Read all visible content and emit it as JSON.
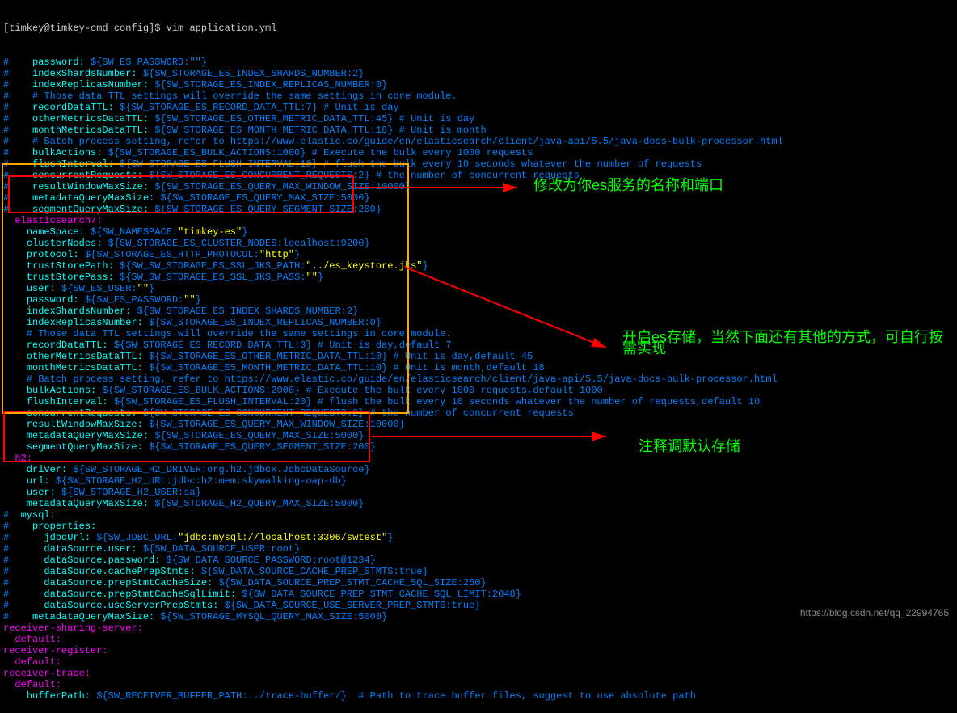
{
  "prompt": "[timkey@timkey-cmd config]$ vim application.yml",
  "lines": [
    {
      "h": "#",
      "k": "    password:",
      "v": " ${SW_ES_PASSWORD:\"\"}"
    },
    {
      "h": "#",
      "k": "    indexShardsNumber:",
      "v": " ${SW_STORAGE_ES_INDEX_SHARDS_NUMBER:2}"
    },
    {
      "h": "#",
      "k": "    indexReplicasNumber:",
      "v": " ${SW_STORAGE_ES_INDEX_REPLICAS_NUMBER:0}"
    },
    {
      "h": "#",
      "c": "    # Those data TTL settings will override the same settings in core module."
    },
    {
      "h": "#",
      "k": "    recordDataTTL:",
      "v": " ${SW_STORAGE_ES_RECORD_DATA_TTL:7}",
      "c": " # Unit is day"
    },
    {
      "h": "#",
      "k": "    otherMetricsDataTTL:",
      "v": " ${SW_STORAGE_ES_OTHER_METRIC_DATA_TTL:45}",
      "c": " # Unit is day"
    },
    {
      "h": "#",
      "k": "    monthMetricsDataTTL:",
      "v": " ${SW_STORAGE_ES_MONTH_METRIC_DATA_TTL:18}",
      "c": " # Unit is month"
    },
    {
      "h": "#",
      "c": "    # Batch process setting, refer to https://www.elastic.co/guide/en/elasticsearch/client/java-api/5.5/java-docs-bulk-processor.html"
    },
    {
      "h": "#",
      "k": "    bulkActions:",
      "v": " ${SW_STORAGE_ES_BULK_ACTIONS:1000}",
      "c": " # Execute the bulk every 1000 requests"
    },
    {
      "h": "#",
      "k": "    flushInterval:",
      "v": " ${SW_STORAGE_ES_FLUSH_INTERVAL:10}",
      "c": " # flush the bulk every 10 seconds whatever the number of requests"
    },
    {
      "h": "#",
      "k": "    concurrentRequests:",
      "v": " ${SW_STORAGE_ES_CONCURRENT_REQUESTS:2}",
      "c": " # the number of concurrent requests"
    },
    {
      "h": "#",
      "k": "    resultWindowMaxSize:",
      "v": " ${SW_STORAGE_ES_QUERY_MAX_WINDOW_SIZE:10000}"
    },
    {
      "h": "#",
      "k": "    metadataQueryMaxSize:",
      "v": " ${SW_STORAGE_ES_QUERY_MAX_SIZE:5000}"
    },
    {
      "h": "#",
      "k": "    segmentQueryMaxSize:",
      "v": " ${SW_STORAGE_ES_QUERY_SEGMENT_SIZE:200}"
    },
    {
      "k": "  elasticsearch7:",
      "sect": true
    },
    {
      "k": "    nameSpace:",
      "v": " ${SW_NAMESPACE:",
      "str": "\"timkey-es\"",
      "v2": "}"
    },
    {
      "k": "    clusterNodes:",
      "v": " ${SW_STORAGE_ES_CLUSTER_NODES:localhost:9200}"
    },
    {
      "k": "    protocol:",
      "v": " ${SW_STORAGE_ES_HTTP_PROTOCOL:",
      "str": "\"http\"",
      "v2": "}"
    },
    {
      "k": "    trustStorePath:",
      "v": " ${SW_SW_STORAGE_ES_SSL_JKS_PATH:",
      "str": "\"../es_keystore.jks\"",
      "v2": "}"
    },
    {
      "k": "    trustStorePass:",
      "v": " ${SW_SW_STORAGE_ES_SSL_JKS_PASS:",
      "str": "\"\"",
      "v2": "}"
    },
    {
      "k": "    user:",
      "v": " ${SW_ES_USER:",
      "str": "\"\"",
      "v2": "}"
    },
    {
      "k": "    password:",
      "v": " ${SW_ES_PASSWORD:",
      "str": "\"\"",
      "v2": "}"
    },
    {
      "k": "    indexShardsNumber:",
      "v": " ${SW_STORAGE_ES_INDEX_SHARDS_NUMBER:2}"
    },
    {
      "k": "    indexReplicasNumber:",
      "v": " ${SW_STORAGE_ES_INDEX_REPLICAS_NUMBER:0}"
    },
    {
      "c": "    # Those data TTL settings will override the same settings in core module."
    },
    {
      "k": "    recordDataTTL:",
      "v": " ${SW_STORAGE_ES_RECORD_DATA_TTL:3}",
      "c": " # Unit is day,default 7"
    },
    {
      "k": "    otherMetricsDataTTL:",
      "v": " ${SW_STORAGE_ES_OTHER_METRIC_DATA_TTL:10}",
      "c": " # Unit is day,default 45"
    },
    {
      "k": "    monthMetricsDataTTL:",
      "v": " ${SW_STORAGE_ES_MONTH_METRIC_DATA_TTL:10}",
      "c": " # Unit is month,default 18"
    },
    {
      "c": "    # Batch process setting, refer to https://www.elastic.co/guide/en/elasticsearch/client/java-api/5.5/java-docs-bulk-processor.html"
    },
    {
      "k": "    bulkActions:",
      "v": " ${SW_STORAGE_ES_BULK_ACTIONS:2000}",
      "c": " # Execute the bulk every 1000 requests,default 1000"
    },
    {
      "k": "    flushInterval:",
      "v": " ${SW_STORAGE_ES_FLUSH_INTERVAL:20}",
      "c": " # flush the bulk every 10 seconds whatever the number of requests,default 10"
    },
    {
      "k": "    concurrentRequests:",
      "v": " ${SW_STORAGE_ES_CONCURRENT_REQUESTS:2}",
      "c": " # the number of concurrent requests"
    },
    {
      "k": "    resultWindowMaxSize:",
      "v": " ${SW_STORAGE_ES_QUERY_MAX_WINDOW_SIZE:10000}"
    },
    {
      "k": "    metadataQueryMaxSize:",
      "v": " ${SW_STORAGE_ES_QUERY_MAX_SIZE:5000}"
    },
    {
      "k": "    segmentQueryMaxSize:",
      "v": " ${SW_STORAGE_ES_QUERY_SEGMENT_SIZE:200}"
    },
    {
      "k": "  h2:",
      "sect": true
    },
    {
      "k": "    driver:",
      "v": " ${SW_STORAGE_H2_DRIVER:org.h2.jdbcx.JdbcDataSource}"
    },
    {
      "k": "    url:",
      "v": " ${SW_STORAGE_H2_URL:jdbc:h2:mem:skywalking-oap-db}"
    },
    {
      "k": "    user:",
      "v": " ${SW_STORAGE_H2_USER:sa}"
    },
    {
      "k": "    metadataQueryMaxSize:",
      "v": " ${SW_STORAGE_H2_QUERY_MAX_SIZE:5000}"
    },
    {
      "h": "#",
      "k": "  mysql:"
    },
    {
      "h": "#",
      "k": "    properties:"
    },
    {
      "h": "#",
      "k": "      jdbcUrl:",
      "v": " ${SW_JDBC_URL:",
      "str": "\"jdbc:mysql://localhost:3306/swtest\"",
      "v2": "}"
    },
    {
      "h": "#",
      "k": "      dataSource.user:",
      "v": " ${SW_DATA_SOURCE_USER:root}"
    },
    {
      "h": "#",
      "k": "      dataSource.password:",
      "v": " ${SW_DATA_SOURCE_PASSWORD:root@1234}"
    },
    {
      "h": "#",
      "k": "      dataSource.cachePrepStmts:",
      "v": " ${SW_DATA_SOURCE_CACHE_PREP_STMTS:true}"
    },
    {
      "h": "#",
      "k": "      dataSource.prepStmtCacheSize:",
      "v": " ${SW_DATA_SOURCE_PREP_STMT_CACHE_SQL_SIZE:250}"
    },
    {
      "h": "#",
      "k": "      dataSource.prepStmtCacheSqlLimit:",
      "v": " ${SW_DATA_SOURCE_PREP_STMT_CACHE_SQL_LIMIT:2048}"
    },
    {
      "h": "#",
      "k": "      dataSource.useServerPrepStmts:",
      "v": " ${SW_DATA_SOURCE_USE_SERVER_PREP_STMTS:true}"
    },
    {
      "h": "#",
      "k": "    metadataQueryMaxSize:",
      "v": " ${SW_STORAGE_MYSQL_QUERY_MAX_SIZE:5000}"
    },
    {
      "s": "receiver-sharing-server:"
    },
    {
      "s": "  default:"
    },
    {
      "s": "receiver-register:"
    },
    {
      "s": "  default:"
    },
    {
      "s": "receiver-trace:"
    },
    {
      "s": "  default:"
    },
    {
      "k": "    bufferPath:",
      "v": " ${SW_RECEIVER_BUFFER_PATH:../trace-buffer/}",
      "c": "  # Path to trace buffer files, suggest to use absolute path"
    }
  ],
  "annotations": {
    "a1": "修改为你es服务的名称和端口",
    "a2": "开启es存储，当然下面还有其他的方式，可自行按需实现",
    "a3": "注释调默认存储"
  },
  "watermark": "https://blog.csdn.net/qq_22994765"
}
